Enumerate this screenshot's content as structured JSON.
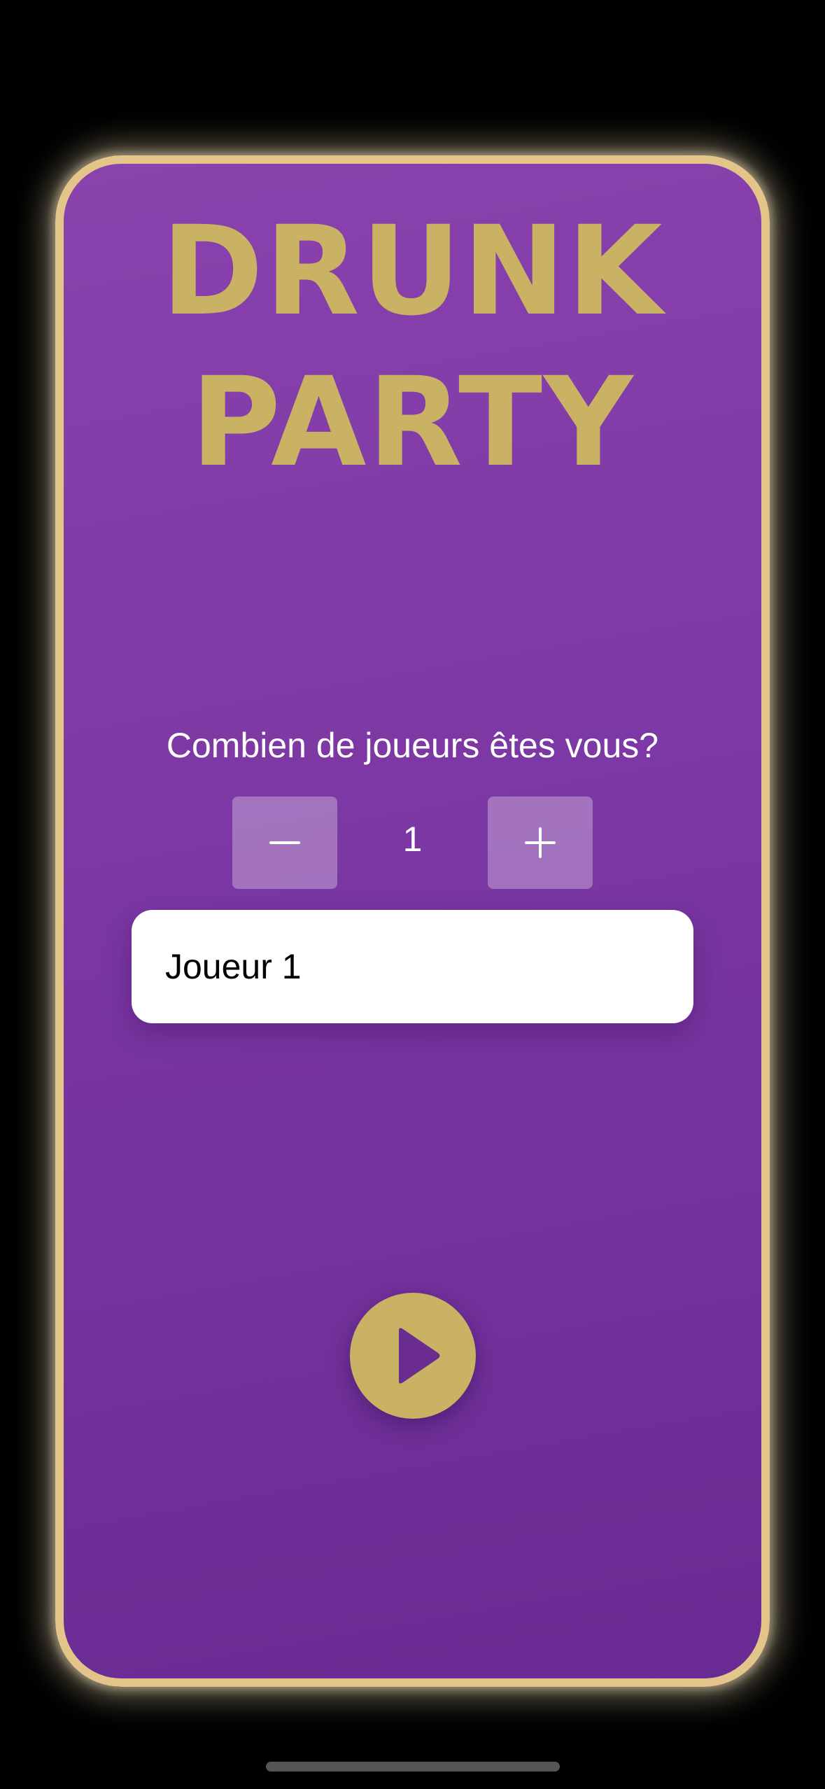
{
  "app": {
    "title_line_1": "DRUNK",
    "title_line_2": "PARTY"
  },
  "players": {
    "question": "Combien de joueurs êtes vous?",
    "count": "1",
    "decrement_icon": "minus-icon",
    "increment_icon": "plus-icon",
    "fields": [
      {
        "value": "Joueur 1"
      }
    ]
  },
  "actions": {
    "play_icon": "play-icon"
  },
  "colors": {
    "accent_gold": "#c9b263",
    "border_gold": "#e3c58a",
    "background_purple_top": "#8a42ad",
    "background_purple_bottom": "#692b93",
    "text_white": "#ffffff"
  }
}
